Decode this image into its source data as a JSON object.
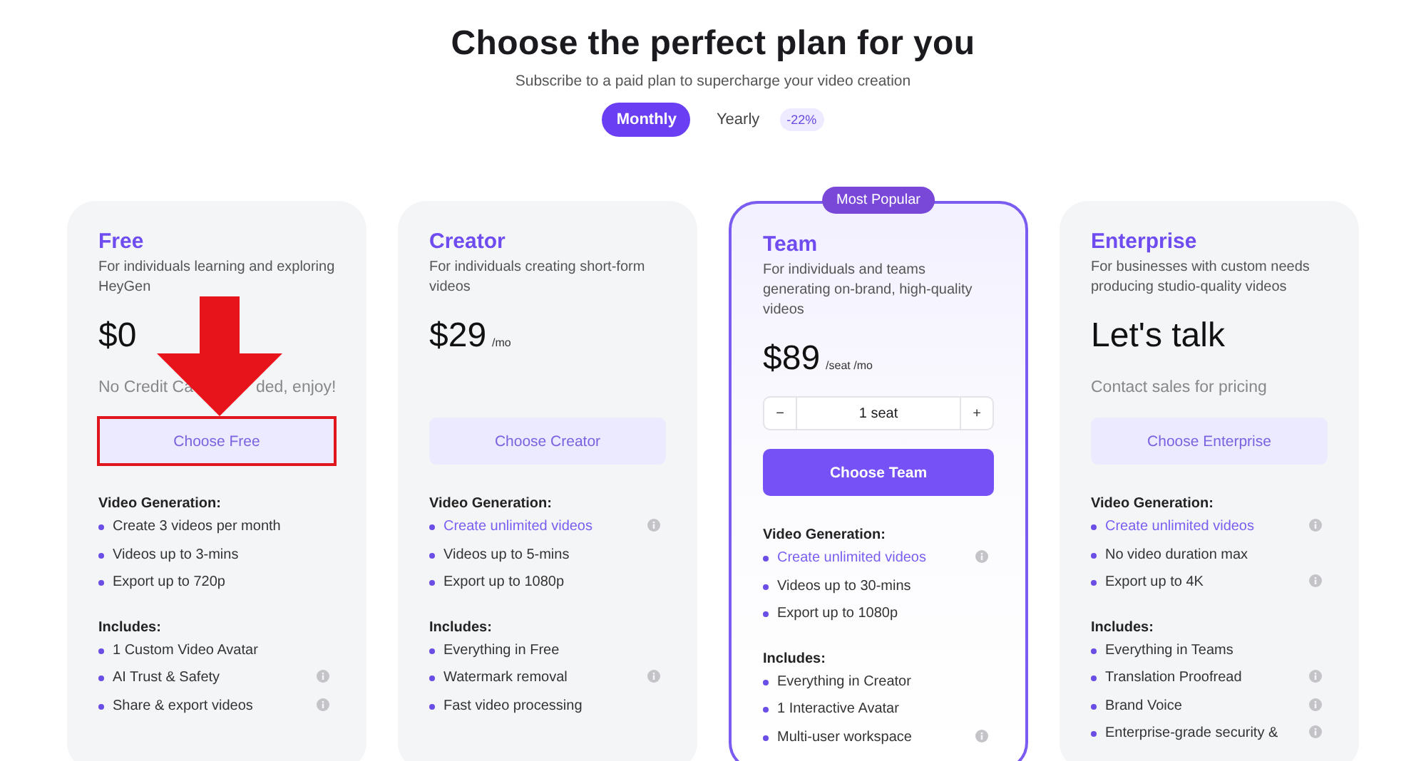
{
  "header": {
    "title": "Choose the perfect plan for you",
    "subtitle": "Subscribe to a paid plan to supercharge your video creation"
  },
  "billing": [
    {
      "label": "Monthly",
      "selected": true
    },
    {
      "label": "Yearly",
      "selected": false,
      "badge": "-22%"
    }
  ],
  "plans": [
    {
      "name": "Free",
      "description": "For individuals learning and exploring HeyGen",
      "price": "$0",
      "note_parts": [
        "No Credit Ca",
        "ded, enjoy!"
      ],
      "button": "Choose Free",
      "primary": false,
      "annotated": true,
      "sections": [
        {
          "heading": "Video Generation:",
          "items": [
            {
              "text": "Create 3 videos per month",
              "highlight": false,
              "info": false
            },
            {
              "text": "Videos up to 3-mins",
              "highlight": false,
              "info": false
            },
            {
              "text": "Export up to 720p",
              "highlight": false,
              "info": false
            }
          ]
        },
        {
          "heading": "Includes:",
          "items": [
            {
              "text": "1 Custom Video Avatar",
              "highlight": false,
              "info": false
            },
            {
              "text": "AI Trust & Safety",
              "highlight": false,
              "info": true
            },
            {
              "text": "Share & export videos",
              "highlight": false,
              "info": true
            }
          ]
        }
      ]
    },
    {
      "name": "Creator",
      "description": "For individuals creating short-form videos",
      "price": "$29",
      "unit": "/mo",
      "button": "Choose Creator",
      "primary": false,
      "annotated": false,
      "sections": [
        {
          "heading": "Video Generation:",
          "items": [
            {
              "text": "Create unlimited videos",
              "highlight": true,
              "info": true
            },
            {
              "text": "Videos up to 5-mins",
              "highlight": false,
              "info": false
            },
            {
              "text": "Export up to 1080p",
              "highlight": false,
              "info": false
            }
          ]
        },
        {
          "heading": "Includes:",
          "items": [
            {
              "text": "Everything in Free",
              "highlight": false,
              "info": false
            },
            {
              "text": "Watermark removal",
              "highlight": false,
              "info": true
            },
            {
              "text": "Fast video processing",
              "highlight": false,
              "info": false
            }
          ]
        }
      ]
    },
    {
      "name": "Team",
      "badge": "Most Popular",
      "description": "For individuals and teams generating on-brand, high-quality videos",
      "price": "$89",
      "unit": "/seat /mo",
      "seats": {
        "minus": "−",
        "value": "1 seat",
        "plus": "+"
      },
      "button": "Choose Team",
      "primary": true,
      "annotated": false,
      "sections": [
        {
          "heading": "Video Generation:",
          "items": [
            {
              "text": "Create unlimited videos",
              "highlight": true,
              "info": true
            },
            {
              "text": "Videos up to 30-mins",
              "highlight": false,
              "info": false
            },
            {
              "text": "Export up to 1080p",
              "highlight": false,
              "info": false
            }
          ]
        },
        {
          "heading": "Includes:",
          "items": [
            {
              "text": "Everything in Creator",
              "highlight": false,
              "info": false
            },
            {
              "text": "1 Interactive Avatar",
              "highlight": false,
              "info": false
            },
            {
              "text": "Multi-user workspace",
              "highlight": false,
              "info": true
            }
          ]
        }
      ]
    },
    {
      "name": "Enterprise",
      "description": "For businesses with custom needs producing studio-quality videos",
      "price": "Let's talk",
      "note_parts": [
        "Contact sales for pricing"
      ],
      "button": "Choose Enterprise",
      "primary": false,
      "annotated": false,
      "sections": [
        {
          "heading": "Video Generation:",
          "items": [
            {
              "text": "Create unlimited videos",
              "highlight": true,
              "info": true
            },
            {
              "text": "No video duration max",
              "highlight": false,
              "info": false
            },
            {
              "text": "Export up to 4K",
              "highlight": false,
              "info": true
            }
          ]
        },
        {
          "heading": "Includes:",
          "items": [
            {
              "text": "Everything in Teams",
              "highlight": false,
              "info": false
            },
            {
              "text": "Translation Proofread",
              "highlight": false,
              "info": true
            },
            {
              "text": "Brand Voice",
              "highlight": false,
              "info": true
            },
            {
              "text": "Enterprise-grade security &",
              "highlight": false,
              "info": true
            }
          ]
        }
      ]
    }
  ]
}
